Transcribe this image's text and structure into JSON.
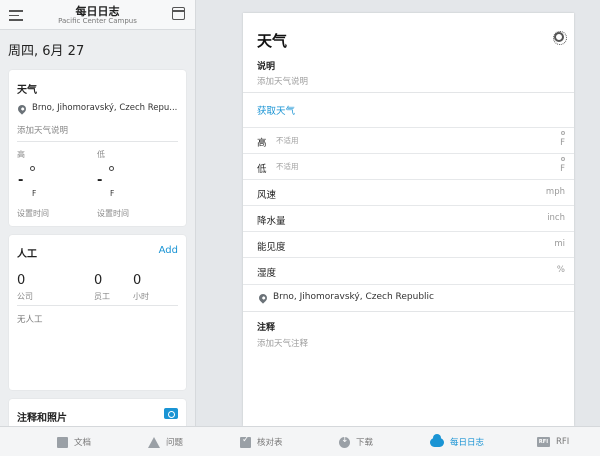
{
  "header": {
    "title": "每日日志",
    "subtitle": "Pacific Center Campus",
    "menu_icon": "hamburger-menu-icon",
    "calendar_icon": "calendar-icon"
  },
  "date_label": "周四, 6月 27",
  "weather_card": {
    "title": "天气",
    "location": "Brno, Jihomoravský, Czech Repu...",
    "add_description": "添加天气说明",
    "high_label": "高",
    "low_label": "低",
    "high_value": "-",
    "low_value": "-",
    "unit": "F",
    "set_time_1": "设置时间",
    "set_time_2": "设置时间"
  },
  "labor_card": {
    "title": "人工",
    "add_label": "Add",
    "companies_value": "0",
    "companies_label": "公司",
    "workers_value": "0",
    "workers_label": "员工",
    "hours_value": "0",
    "hours_label": "小时",
    "empty_text": "无人工"
  },
  "notes_card": {
    "title": "注释和照片"
  },
  "detail": {
    "title": "天气",
    "description_label": "说明",
    "description_placeholder": "添加天气说明",
    "fetch_weather": "获取天气",
    "rows": [
      {
        "label": "高",
        "placeholder": "不适用",
        "unit": "F"
      },
      {
        "label": "低",
        "placeholder": "不适用",
        "unit": "F"
      },
      {
        "label": "风速",
        "placeholder": "",
        "unit": "mph"
      },
      {
        "label": "降水量",
        "placeholder": "",
        "unit": "inch"
      },
      {
        "label": "能见度",
        "placeholder": "",
        "unit": "mi"
      },
      {
        "label": "湿度",
        "placeholder": "",
        "unit": "%"
      }
    ],
    "location": "Brno, Jihomoravský, Czech Republic",
    "notes_label": "注释",
    "notes_placeholder": "添加天气注释"
  },
  "tabs": [
    {
      "label": "文档",
      "icon": "document-icon",
      "active": false
    },
    {
      "label": "问题",
      "icon": "warning-icon",
      "active": false
    },
    {
      "label": "核对表",
      "icon": "checklist-icon",
      "active": false
    },
    {
      "label": "下载",
      "icon": "download-icon",
      "active": false
    },
    {
      "label": "每日日志",
      "icon": "weather-cloud-icon",
      "active": true
    },
    {
      "label": "RFI",
      "icon": "rfi-icon",
      "active": false
    }
  ],
  "colors": {
    "accent": "#1a94d4",
    "background": "#e4e7ea"
  }
}
